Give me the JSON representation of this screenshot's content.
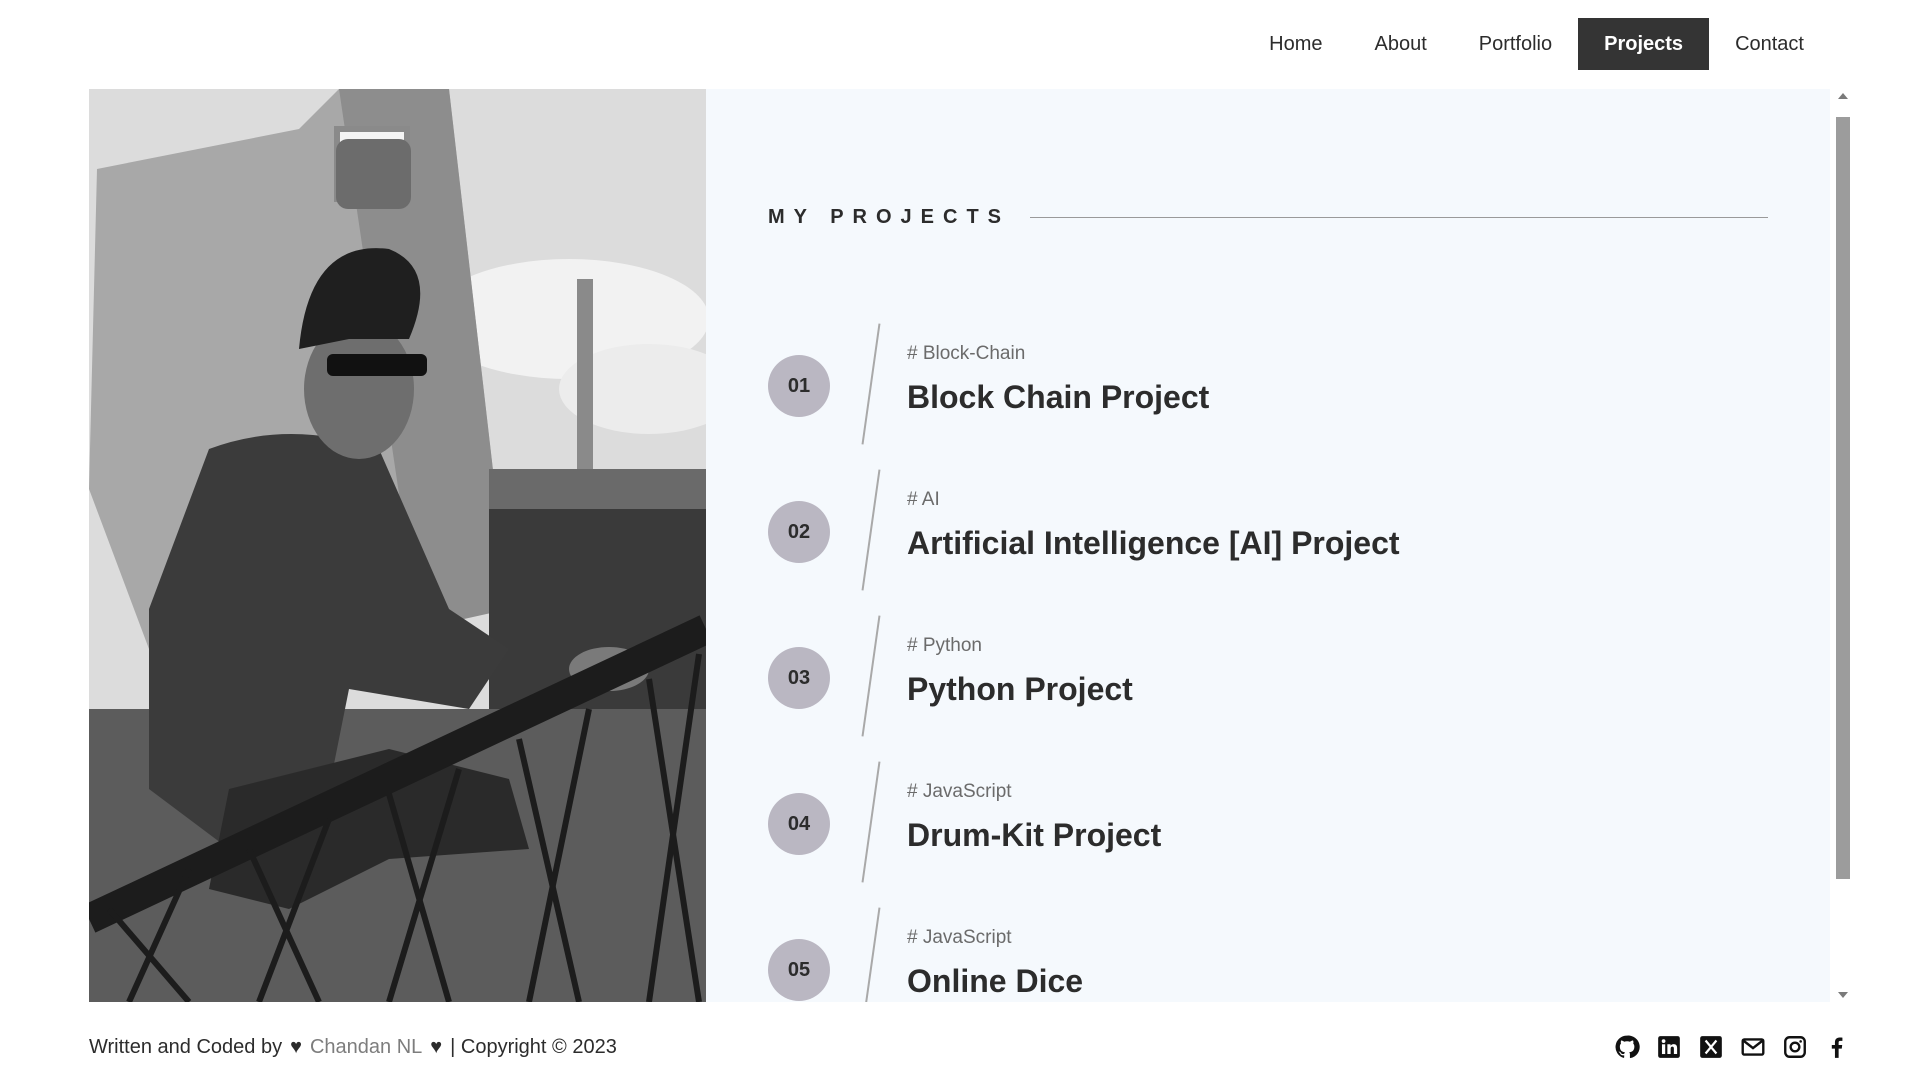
{
  "nav": {
    "items": [
      {
        "label": "Home"
      },
      {
        "label": "About"
      },
      {
        "label": "Portfolio"
      },
      {
        "label": "Projects",
        "active": true
      },
      {
        "label": "Contact"
      }
    ]
  },
  "section": {
    "title": "MY PROJECTS"
  },
  "projects": [
    {
      "number": "01",
      "tag": "# Block-Chain",
      "title": "Block Chain Project"
    },
    {
      "number": "02",
      "tag": "# AI",
      "title": "Artificial Intelligence [AI] Project"
    },
    {
      "number": "03",
      "tag": "# Python",
      "title": "Python Project"
    },
    {
      "number": "04",
      "tag": "# JavaScript",
      "title": "Drum-Kit Project"
    },
    {
      "number": "05",
      "tag": "# JavaScript",
      "title": "Online Dice"
    }
  ],
  "footer": {
    "prefix": "Written and Coded by",
    "author": "Chandan NL",
    "suffix": "| Copyright © 2023",
    "socials": [
      {
        "icon": "github-icon"
      },
      {
        "icon": "linkedin-icon"
      },
      {
        "icon": "x-twitter-icon"
      },
      {
        "icon": "mail-icon"
      },
      {
        "icon": "instagram-icon"
      },
      {
        "icon": "facebook-icon"
      }
    ]
  },
  "colors": {
    "nav_active_bg": "#343434",
    "panel_bg": "#f5f9fd",
    "badge_bg": "#bab7c2",
    "text": "#2c2c2c",
    "muted": "#6b6b6b"
  }
}
